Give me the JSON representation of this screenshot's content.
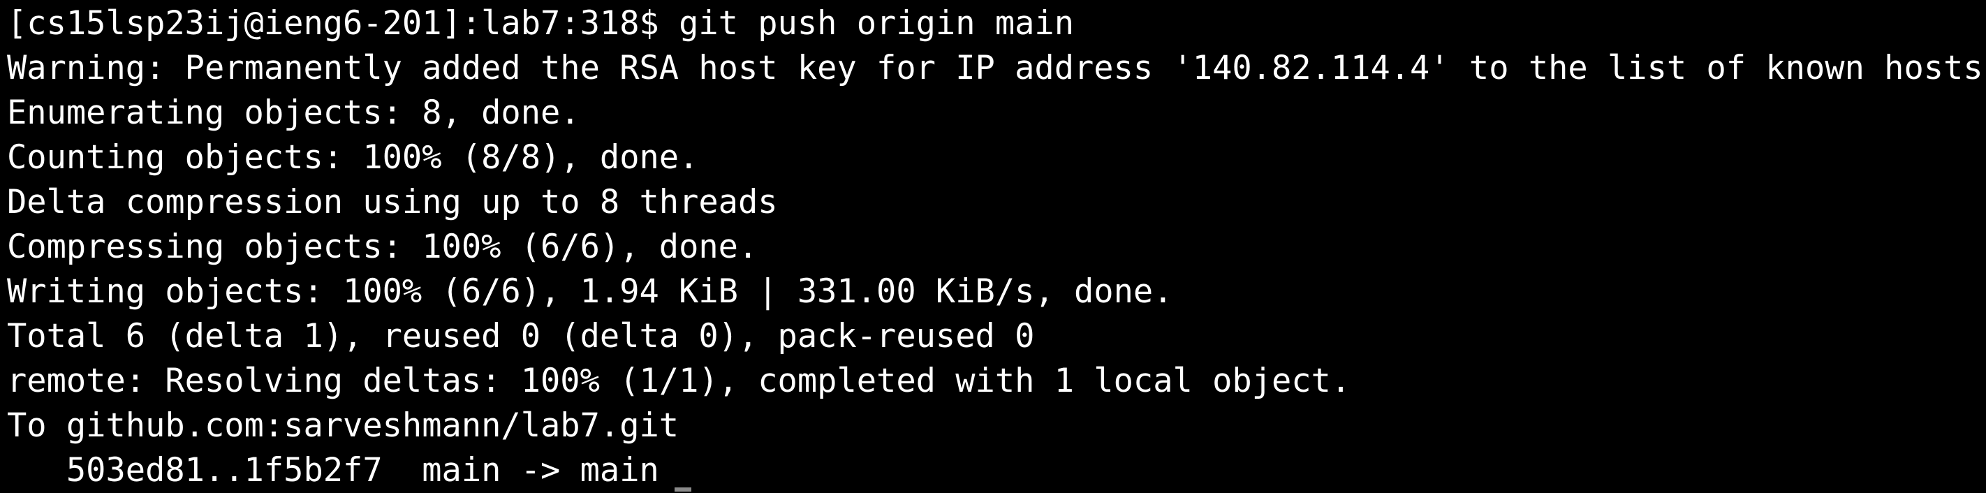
{
  "terminal": {
    "lines": [
      "[cs15lsp23ij@ieng6-201]:lab7:318$ git push origin main",
      "Warning: Permanently added the RSA host key for IP address '140.82.114.4' to the list of known hosts.",
      "Enumerating objects: 8, done.",
      "Counting objects: 100% (8/8), done.",
      "Delta compression using up to 8 threads",
      "Compressing objects: 100% (6/6), done.",
      "Writing objects: 100% (6/6), 1.94 KiB | 331.00 KiB/s, done.",
      "Total 6 (delta 1), reused 0 (delta 0), pack-reused 0",
      "remote: Resolving deltas: 100% (1/1), completed with 1 local object.",
      "To github.com:sarveshmann/lab7.git",
      "   503ed81..1f5b2f7  main -> main"
    ]
  },
  "colors": {
    "background": "#000000",
    "text": "#ffffff",
    "cursor": "#8a8a8a"
  }
}
